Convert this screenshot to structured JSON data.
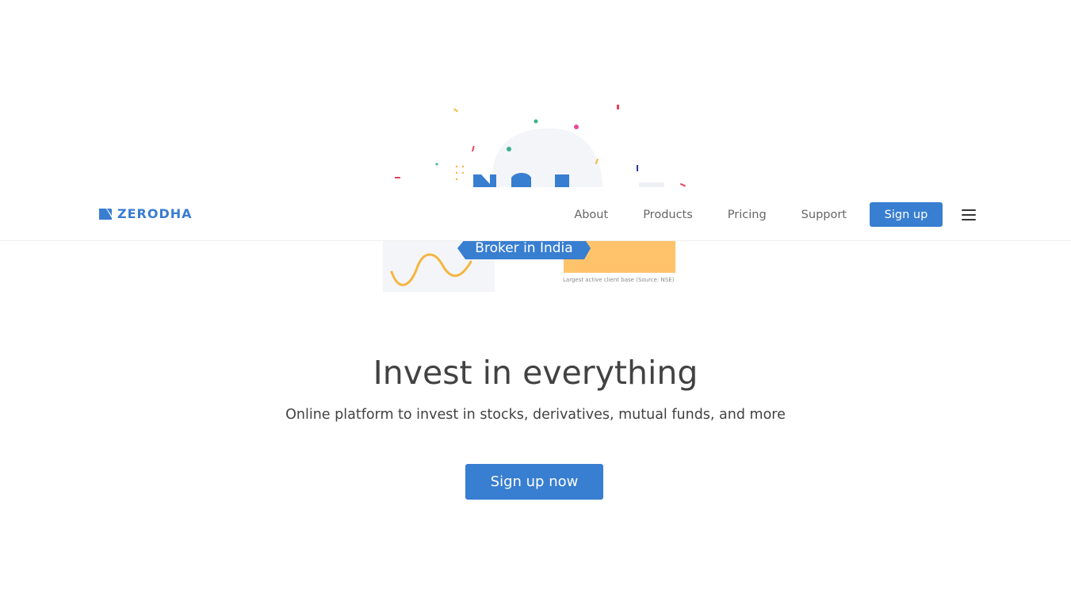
{
  "brand": {
    "logo_text": "ZERODHA",
    "logo_icon": "zerodha-kite-mark",
    "accent_color": "#387ed1"
  },
  "nav": {
    "links": [
      {
        "label": "About"
      },
      {
        "label": "Products"
      },
      {
        "label": "Pricing"
      },
      {
        "label": "Support"
      }
    ],
    "signup_label": "Sign up",
    "menu_icon": "hamburger-menu-icon"
  },
  "hero_illustration": {
    "ribbon_text": "Broker in India",
    "caption": "Largest active client base (Source: NSE)"
  },
  "hero": {
    "heading": "Invest in everything",
    "subheading": "Online platform to invest in stocks, derivatives, mutual funds, and more",
    "cta_label": "Sign up now"
  }
}
